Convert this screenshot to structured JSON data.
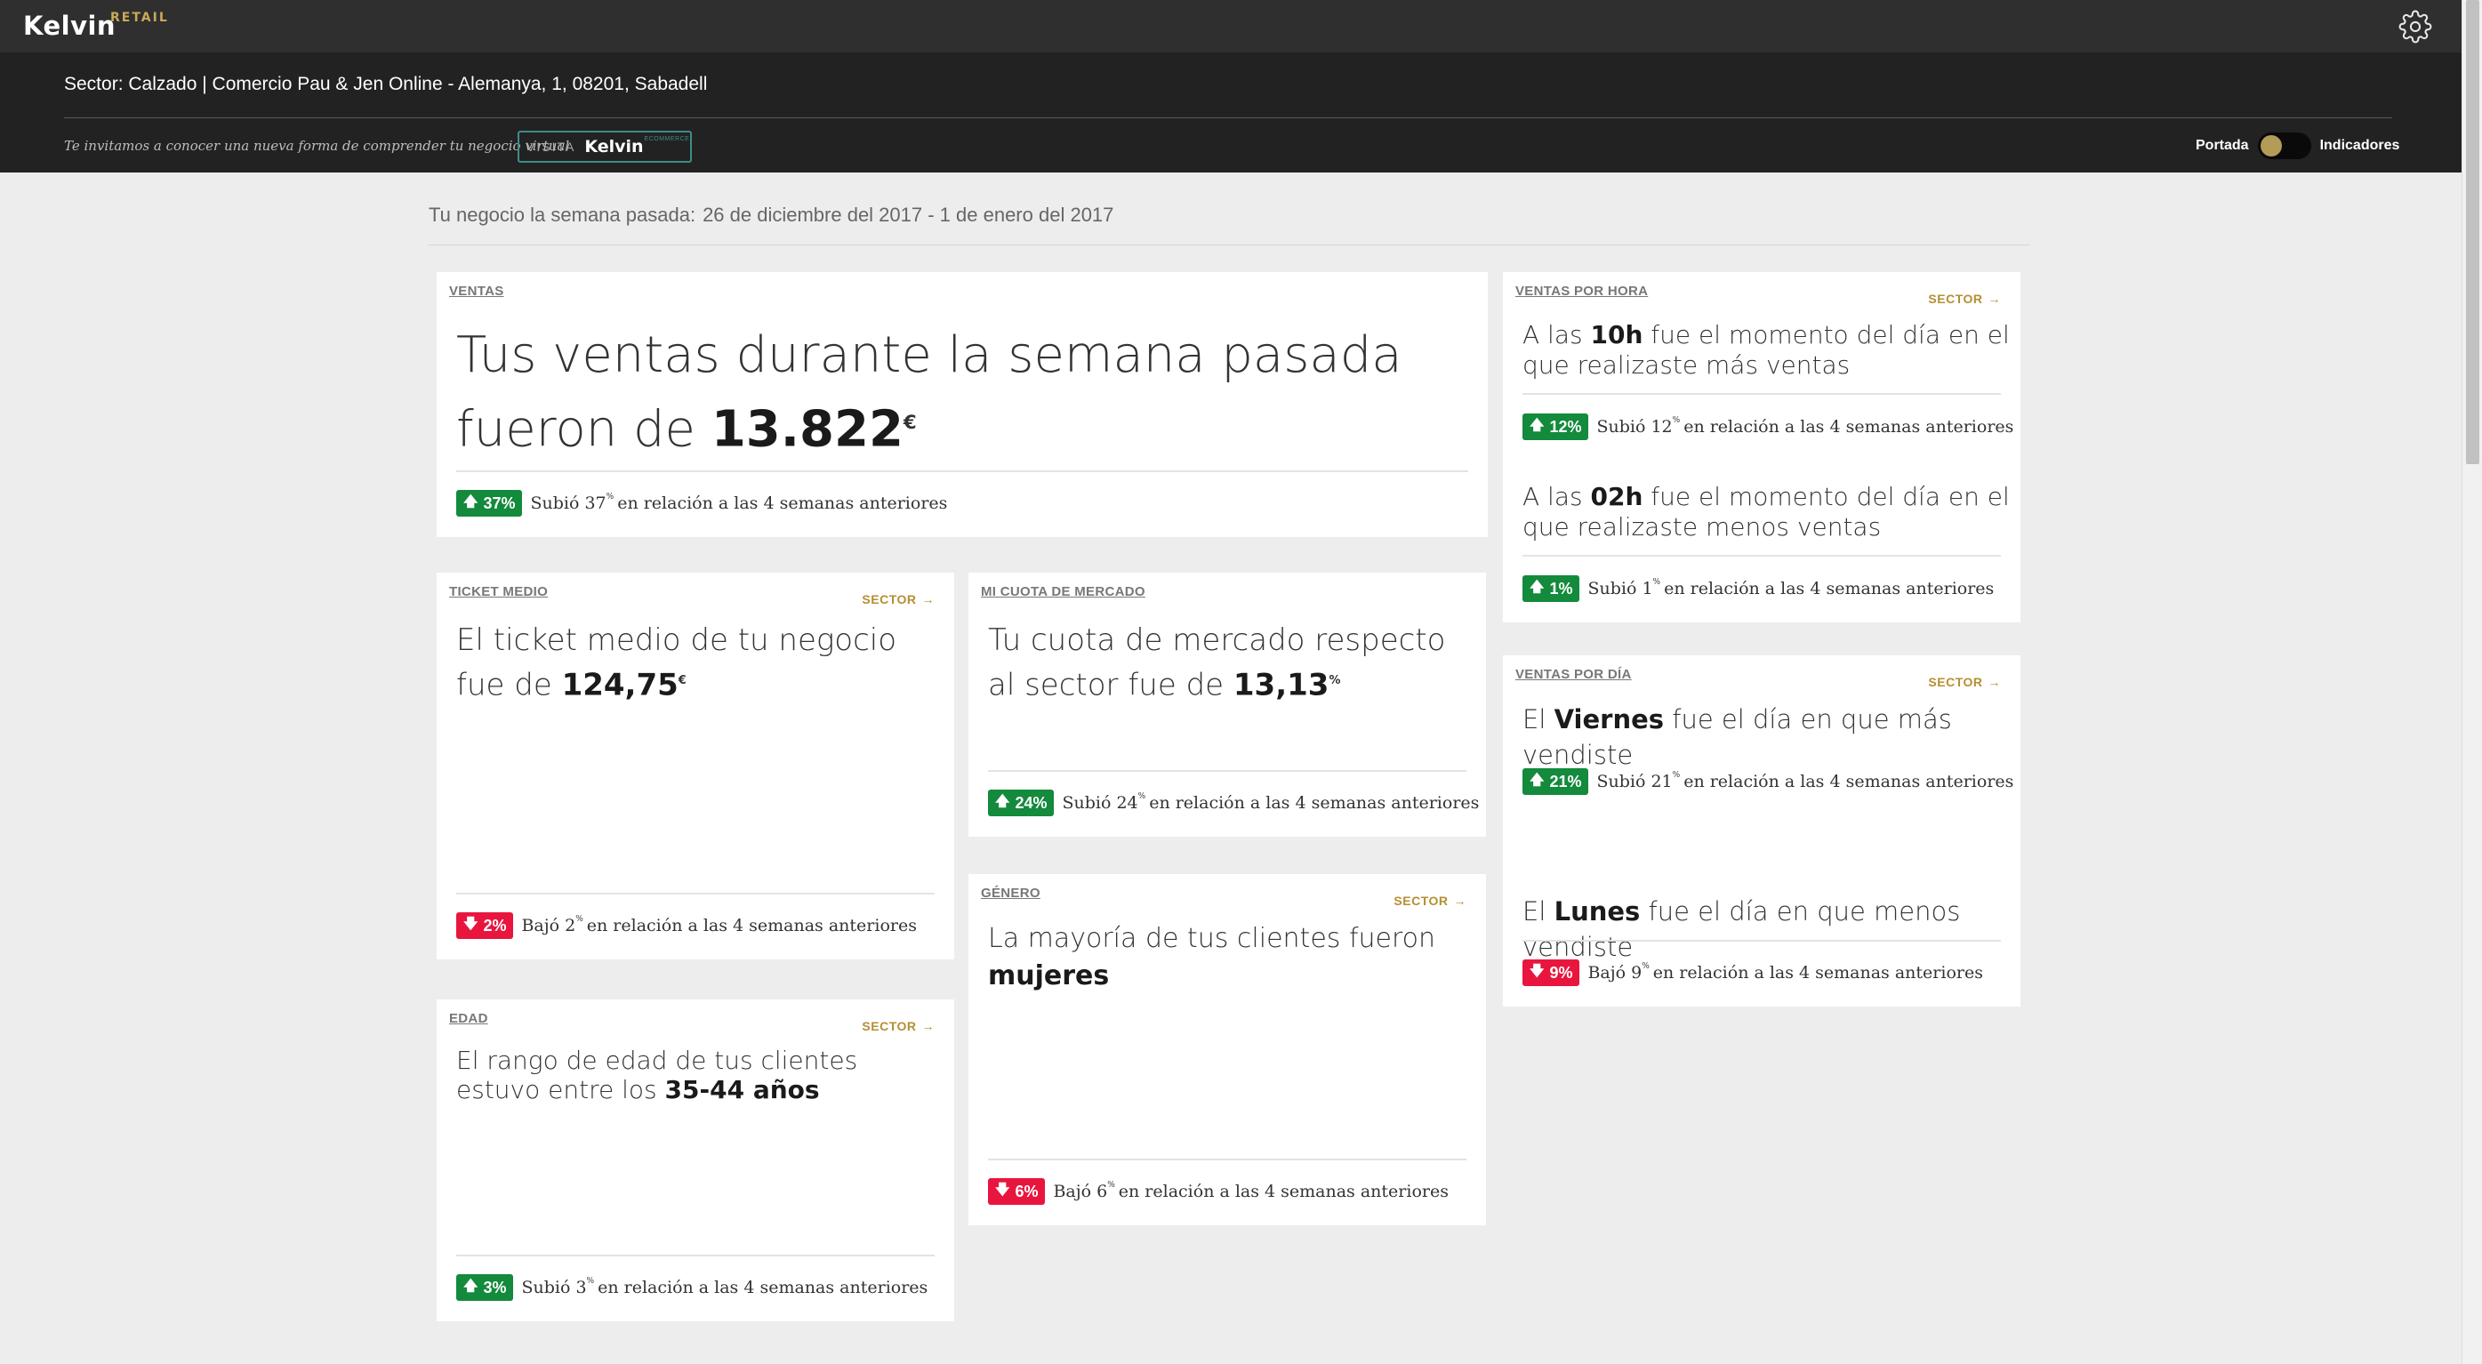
{
  "app": {
    "brand": "Kelvin",
    "brand_sup": "RETAIL",
    "settings_icon": "gear-icon"
  },
  "header": {
    "sector_line": "Sector: Calzado | Comercio Pau & Jen Online - Alemanya, 1, 08201, Sabadell",
    "invite_text": "Te invitamos a conocer una nueva forma de comprender tu negocio virtual",
    "visit_prefix": "VISITA",
    "visit_brand": "Kelvin",
    "visit_sup": "ECOMMERCE",
    "toggle_left": "Portada",
    "toggle_right": "Indicadores"
  },
  "week": {
    "label": "Tu negocio la semana pasada:",
    "dates": "26 de diciembre del 2017 - 1 de enero del 2017"
  },
  "colors": {
    "up": "#138a3c",
    "down": "#e8163e",
    "accent": "#b58f32"
  },
  "cards": {
    "ventas": {
      "tab": "VENTAS",
      "text_a": "Tus ventas durante la semana pasada fueron de ",
      "value": "13.822",
      "unit": "€",
      "badge": "37%",
      "change_a": "Subió 37",
      "change_pc": "%",
      "change_b": " en relación a las 4 semanas anteriores"
    },
    "ticket": {
      "tab": "TICKET MEDIO",
      "sector": "SECTOR",
      "text_a": "El ticket medio de tu negocio fue de ",
      "value": "124,75",
      "unit": "€",
      "badge": "2%",
      "change_a": "Bajó 2",
      "change_pc": "%",
      "change_b": " en relación a las 4 semanas anteriores"
    },
    "cuota": {
      "tab": "MI CUOTA DE MERCADO",
      "text_a": "Tu cuota de mercado respecto al sector fue de ",
      "value": "13,13",
      "unit": "%",
      "badge": "24%",
      "change_a": "Subió 24",
      "change_pc": "%",
      "change_b": " en relación a las 4 semanas anteriores"
    },
    "genero": {
      "tab": "GÉNERO",
      "sector": "SECTOR",
      "text_a": "La mayoría de tus clientes fueron ",
      "value": "mujeres",
      "badge": "6%",
      "change_a": "Bajó 6",
      "change_pc": "%",
      "change_b": " en relación a las 4 semanas anteriores"
    },
    "edad": {
      "tab": "EDAD",
      "sector": "SECTOR",
      "text_a": "El rango de edad de tus clientes estuvo entre los ",
      "value": "35-44 años",
      "badge": "3%",
      "change_a": "Subió 3",
      "change_pc": "%",
      "change_b": " en relación a las 4 semanas anteriores"
    },
    "hora": {
      "tab": "VENTAS POR HORA",
      "sector": "SECTOR",
      "max_a": "A las ",
      "max_value": "10h",
      "max_b": " fue el momento del día en el que realizaste más ventas",
      "max_badge": "12%",
      "max_change_a": "Subió 12",
      "max_change_pc": "%",
      "max_change_b": " en relación a las 4 semanas anteriores",
      "min_a": "A las ",
      "min_value": "02h",
      "min_b": " fue el momento del día en el que realizaste menos ventas",
      "min_badge": "1%",
      "min_change_a": "Subió 1",
      "min_change_pc": "%",
      "min_change_b": " en relación a las 4 semanas anteriores"
    },
    "dia": {
      "tab": "VENTAS POR DÍA",
      "sector": "SECTOR",
      "max_a": "El ",
      "max_value": "Viernes",
      "max_b": " fue el día en que más vendiste",
      "max_badge": "21%",
      "max_change_a": "Subió 21",
      "max_change_pc": "%",
      "max_change_b": " en relación a las 4 semanas anteriores",
      "min_a": "El ",
      "min_value": "Lunes",
      "min_b": " fue el día en que menos vendiste",
      "min_badge": "9%",
      "min_change_a": "Bajó 9",
      "min_change_pc": "%",
      "min_change_b": " en relación a las 4 semanas anteriores"
    }
  }
}
